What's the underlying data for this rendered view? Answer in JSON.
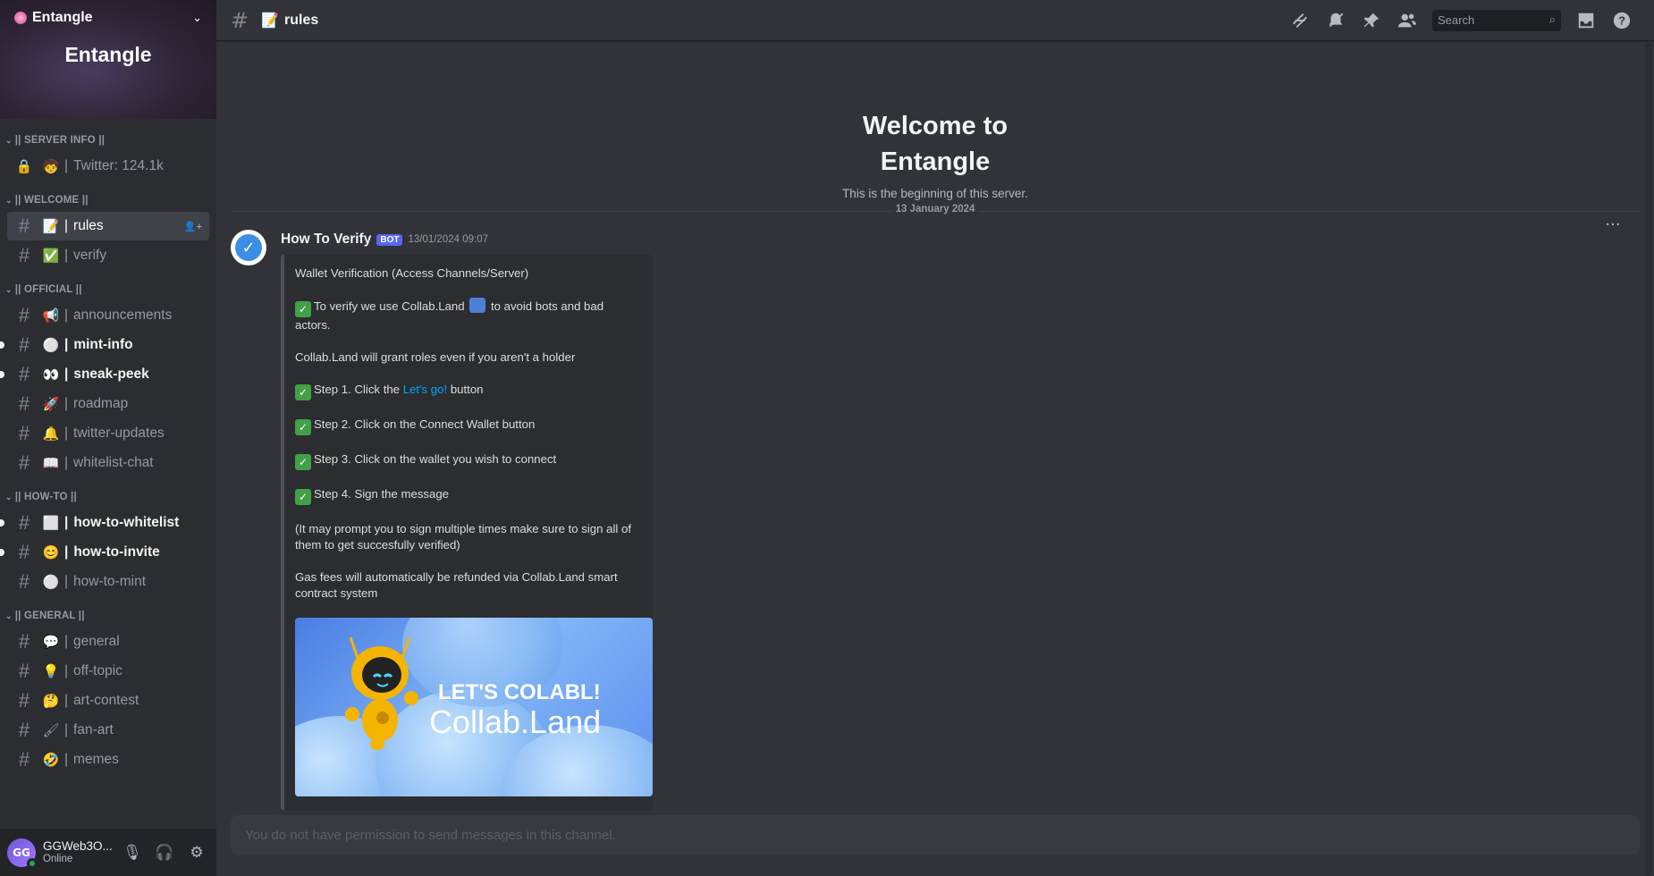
{
  "server": {
    "name": "Entangle",
    "banner_title": "Entangle"
  },
  "categories": [
    {
      "label": "|| SERVER INFO ||",
      "channels": [
        {
          "emoji": "🧒",
          "name": "Twitter: 124.1k",
          "locked": true
        }
      ]
    },
    {
      "label": "|| WELCOME ||",
      "channels": [
        {
          "emoji": "📝",
          "name": "rules",
          "active": true
        },
        {
          "emoji": "✅",
          "name": "verify"
        }
      ]
    },
    {
      "label": "|| OFFICIAL ||",
      "channels": [
        {
          "emoji": "📢",
          "name": "announcements"
        },
        {
          "emoji": "⚪",
          "name": "mint-info",
          "unread": true
        },
        {
          "emoji": "👀",
          "name": "sneak-peek",
          "unread": true
        },
        {
          "emoji": "🚀",
          "name": "roadmap"
        },
        {
          "emoji": "🔔",
          "name": "twitter-updates"
        },
        {
          "emoji": "📖",
          "name": "whitelist-chat"
        }
      ]
    },
    {
      "label": "|| HOW-TO ||",
      "channels": [
        {
          "emoji": "⬜",
          "name": "how-to-whitelist",
          "unread": true
        },
        {
          "emoji": "😊",
          "name": "how-to-invite",
          "unread": true
        },
        {
          "emoji": "⚪",
          "name": "how-to-mint"
        }
      ]
    },
    {
      "label": "|| GENERAL ||",
      "channels": [
        {
          "emoji": "💬",
          "name": "general"
        },
        {
          "emoji": "💡",
          "name": "off-topic"
        },
        {
          "emoji": "🤔",
          "name": "art-contest"
        },
        {
          "emoji": "🖌",
          "name": "fan-art"
        },
        {
          "emoji": "🤣",
          "name": "memes"
        }
      ]
    }
  ],
  "user": {
    "name": "GGWeb3O...",
    "status": "Online",
    "initials": "GG"
  },
  "topbar": {
    "emoji": "📝",
    "channel": "rules",
    "search_placeholder": "Search"
  },
  "welcome": {
    "title_line1": "Welcome to",
    "title_line2": "Entangle",
    "subtitle": "This is the beginning of this server."
  },
  "divider_date": "13 January 2024",
  "message": {
    "author": "How To Verify",
    "bot_tag": "BOT",
    "timestamp": "13/01/2024 09:07",
    "lines": {
      "l1": "Wallet Verification (Access Channels/Server)",
      "l2a": "To verify we use Collab.Land",
      "l2b": "to avoid bots and bad actors.",
      "l3": "Collab.Land will grant roles even if you aren't a holder",
      "l4a": "Step 1. Click the",
      "l4link": "Let's go!",
      "l4b": "button",
      "l5": "Step 2. Click on the Connect Wallet button",
      "l6": "Step 3. Click on the wallet you wish to connect",
      "l7": "Step 4. Sign the message",
      "l8": "(It may prompt you to sign multiple times make sure to sign all of them to get succesfully verified)",
      "l9": "Gas fees will automatically be refunded via Collab.Land smart contract system"
    },
    "image_text1": "LET'S COLABL!",
    "image_text2": "Collab.Land"
  },
  "input_placeholder": "You do not have permission to send messages in this channel."
}
